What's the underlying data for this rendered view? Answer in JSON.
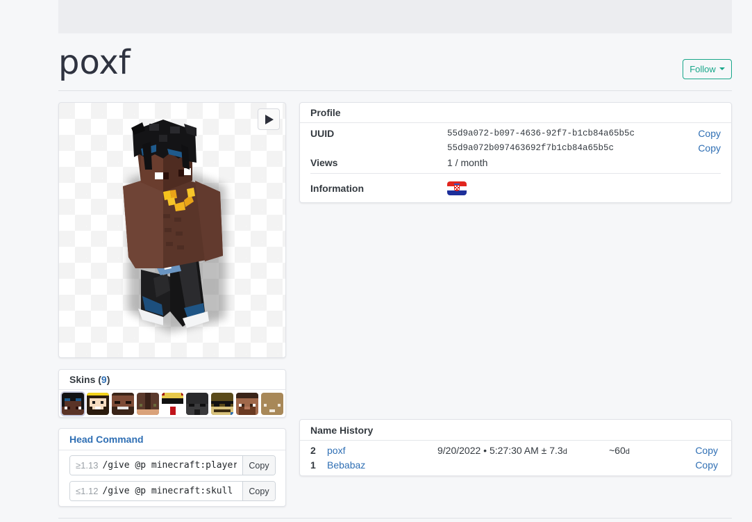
{
  "page": {
    "title": "poxf",
    "follow_label": "Follow"
  },
  "viewer": {
    "play_icon": "play-icon"
  },
  "skins": {
    "title": "Skins",
    "count": "9",
    "items": [
      {
        "name": "skin-1",
        "active": true
      },
      {
        "name": "skin-2",
        "active": false
      },
      {
        "name": "skin-3",
        "active": false
      },
      {
        "name": "skin-4",
        "active": false
      },
      {
        "name": "skin-5",
        "active": false
      },
      {
        "name": "skin-6",
        "active": false
      },
      {
        "name": "skin-7",
        "active": false
      },
      {
        "name": "skin-8",
        "active": false
      },
      {
        "name": "skin-9",
        "active": false
      }
    ]
  },
  "head_command": {
    "title": "Head Command",
    "commands": [
      {
        "version": "≥1.13",
        "command": "/give @p minecraft:player_head",
        "copy_label": "Copy"
      },
      {
        "version": "≤1.12",
        "command": "/give @p minecraft:skull",
        "copy_label": "Copy"
      }
    ]
  },
  "profile": {
    "title": "Profile",
    "uuid_label": "UUID",
    "uuid": "55d9a072-b097-4636-92f7-b1cb84a65b5c",
    "uuid_short": "55d9a072b097463692f7b1cb84a65b5c",
    "copy_label": "Copy",
    "views_label": "Views",
    "views": "1 / month",
    "info_label": "Information",
    "flag": "croatia-flag"
  },
  "name_history": {
    "title": "Name History",
    "rows": [
      {
        "num": "2",
        "name": "poxf",
        "date": "9/20/2022 • 5:27:30 AM ± 7.3",
        "date_unit": "d",
        "duration": "~60",
        "duration_unit": "d",
        "copy_label": "Copy"
      },
      {
        "num": "1",
        "name": "Bebabaz",
        "date": "",
        "date_unit": "",
        "duration": "",
        "duration_unit": "",
        "copy_label": "Copy"
      }
    ]
  },
  "colors": {
    "accent": "#17a689",
    "link": "#2f6fb4",
    "background": "#f6f7f9"
  }
}
